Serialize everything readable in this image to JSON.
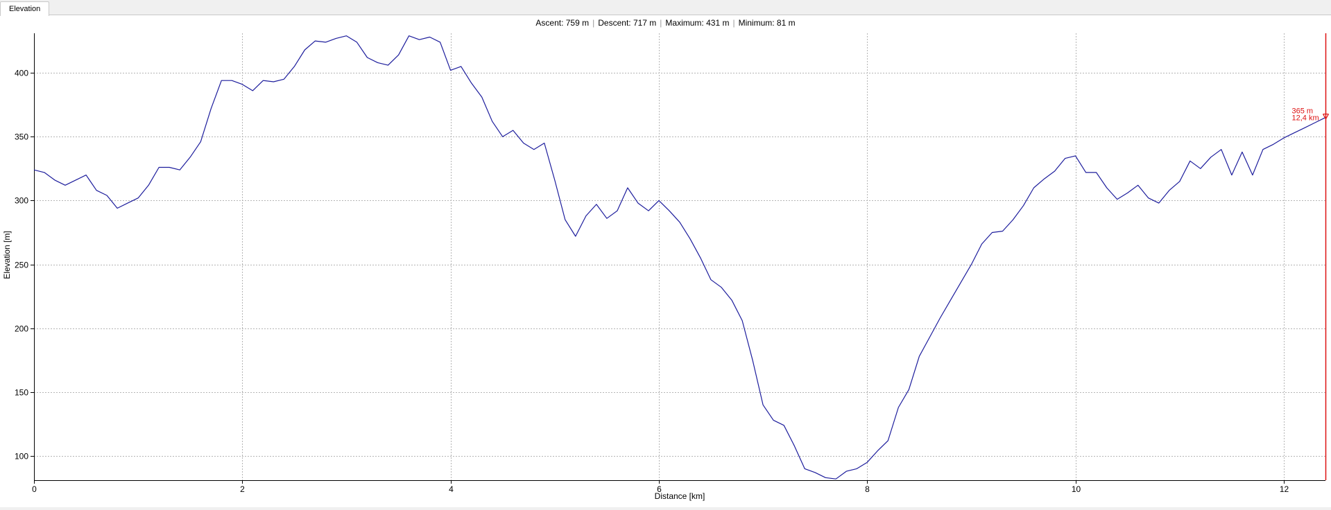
{
  "tab": {
    "label": "Elevation"
  },
  "stats": {
    "ascent": "Ascent: 759 m",
    "descent": "Descent: 717 m",
    "maximum": "Maximum: 431 m",
    "minimum": "Minimum: 81 m"
  },
  "marker": {
    "elevation_label": "365 m",
    "distance_label": "12,4 km",
    "x": 12.4,
    "y": 365
  },
  "colors": {
    "line": "#1c1c9c",
    "marker": "#dd1111",
    "grid": "#b4b4b4",
    "axis": "#000000"
  },
  "chart_data": {
    "type": "line",
    "xlabel": "Distance [km]",
    "ylabel": "Elevation [m]",
    "xlim": [
      0,
      12.4
    ],
    "ylim": [
      81,
      431
    ],
    "xticks": [
      0,
      2,
      4,
      6,
      8,
      10,
      12
    ],
    "yticks": [
      100,
      150,
      200,
      250,
      300,
      350,
      400
    ],
    "grid": true,
    "x": [
      0,
      0.1,
      0.2,
      0.3,
      0.4,
      0.5,
      0.6,
      0.7,
      0.8,
      0.9,
      1.0,
      1.1,
      1.2,
      1.3,
      1.4,
      1.5,
      1.6,
      1.7,
      1.8,
      1.9,
      2.0,
      2.1,
      2.2,
      2.3,
      2.4,
      2.5,
      2.6,
      2.7,
      2.8,
      2.9,
      3.0,
      3.1,
      3.2,
      3.3,
      3.4,
      3.5,
      3.6,
      3.7,
      3.8,
      3.9,
      4.0,
      4.1,
      4.2,
      4.3,
      4.4,
      4.5,
      4.6,
      4.7,
      4.8,
      4.9,
      5.0,
      5.1,
      5.2,
      5.3,
      5.4,
      5.5,
      5.6,
      5.7,
      5.8,
      5.9,
      6.0,
      6.1,
      6.2,
      6.3,
      6.4,
      6.5,
      6.6,
      6.7,
      6.8,
      6.9,
      7.0,
      7.1,
      7.2,
      7.3,
      7.4,
      7.5,
      7.6,
      7.7,
      7.8,
      7.9,
      8.0,
      8.1,
      8.2,
      8.3,
      8.4,
      8.5,
      8.6,
      8.7,
      8.8,
      8.9,
      9.0,
      9.1,
      9.2,
      9.3,
      9.4,
      9.5,
      9.6,
      9.7,
      9.8,
      9.9,
      10.0,
      10.1,
      10.2,
      10.3,
      10.4,
      10.5,
      10.6,
      10.7,
      10.8,
      10.9,
      11.0,
      11.1,
      11.2,
      11.3,
      11.4,
      11.5,
      11.6,
      11.7,
      11.8,
      11.9,
      12.0,
      12.1,
      12.2,
      12.3,
      12.4
    ],
    "y": [
      324,
      322,
      316,
      312,
      316,
      320,
      308,
      304,
      294,
      298,
      302,
      312,
      326,
      326,
      324,
      334,
      346,
      372,
      394,
      394,
      391,
      386,
      394,
      393,
      395,
      405,
      418,
      425,
      424,
      427,
      429,
      424,
      412,
      408,
      406,
      414,
      429,
      426,
      428,
      424,
      402,
      405,
      392,
      381,
      362,
      350,
      355,
      345,
      340,
      345,
      316,
      285,
      272,
      288,
      297,
      286,
      292,
      310,
      298,
      292,
      300,
      292,
      283,
      270,
      255,
      238,
      232,
      222,
      206,
      175,
      140,
      128,
      124,
      108,
      90,
      87,
      83,
      82,
      88,
      90,
      95,
      104,
      112,
      138,
      152,
      178,
      193,
      208,
      222,
      236,
      250,
      266,
      275,
      276,
      285,
      296,
      310,
      317,
      323,
      333,
      335,
      322,
      322,
      310,
      301,
      306,
      312,
      302,
      298,
      308,
      315,
      331,
      325,
      334,
      340,
      320,
      338,
      320,
      340,
      344,
      349,
      353,
      357,
      361,
      365
    ]
  }
}
